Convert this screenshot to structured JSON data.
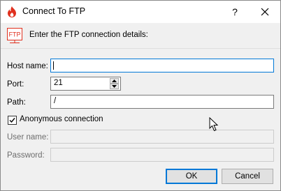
{
  "window": {
    "title": "Connect To FTP",
    "help_label": "?",
    "app_icon": "flame-icon",
    "close_icon": "close-icon"
  },
  "header": {
    "icon_text": "FTP",
    "text": "Enter the FTP connection details:"
  },
  "form": {
    "host": {
      "label": "Host name:",
      "value": ""
    },
    "port": {
      "label": "Port:",
      "value": "21"
    },
    "path": {
      "label": "Path:",
      "value": "/"
    },
    "anonymous": {
      "label": "Anonymous connection",
      "checked": true
    },
    "username": {
      "label": "User name:",
      "value": ""
    },
    "password": {
      "label": "Password:",
      "value": ""
    }
  },
  "buttons": {
    "ok": "OK",
    "cancel": "Cancel"
  },
  "colors": {
    "accent": "#0078d7",
    "icon_red": "#e0301e",
    "dialog_bg": "#f0f0f0"
  }
}
